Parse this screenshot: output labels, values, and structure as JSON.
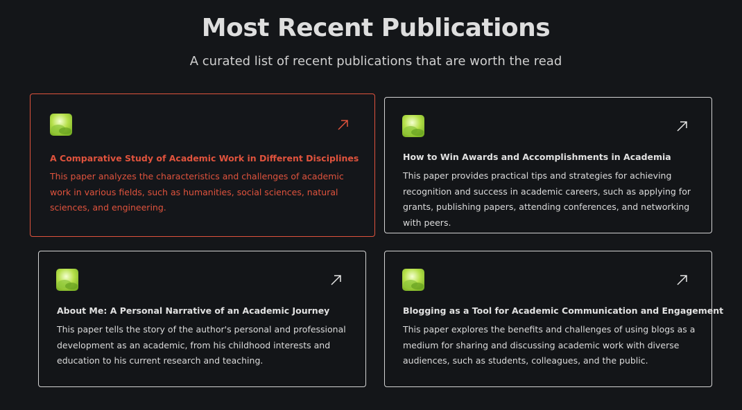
{
  "header": {
    "title": "Most Recent Publications",
    "subtitle": "A curated list of recent publications that are worth the read"
  },
  "colors": {
    "background": "#141619",
    "active_accent": "#e0533d",
    "card_border": "#d4d4d4",
    "thumbnail_green": "#9bd13a"
  },
  "cards": [
    {
      "title": "A Comparative Study of Academic Work in Different Disciplines",
      "description": "This paper analyzes the characteristics and challenges of academic work in various fields, such as humanities, social sciences, natural sciences, and engineering.",
      "icon": "arrow-up-right-icon",
      "active": true
    },
    {
      "title": "How to Win Awards and Accomplishments in Academia",
      "description": "This paper provides practical tips and strategies for achieving recognition and success in academic careers, such as applying for grants, publishing papers, attending conferences, and networking with peers.",
      "icon": "arrow-up-right-icon",
      "active": false
    },
    {
      "title": "About Me: A Personal Narrative of an Academic Journey",
      "description": "This paper tells the story of the author's personal and professional development as an academic, from his childhood interests and education to his current research and teaching.",
      "icon": "arrow-up-right-icon",
      "active": false
    },
    {
      "title": "Blogging as a Tool for Academic Communication and Engagement",
      "description": "This paper explores the benefits and challenges of using blogs as a medium for sharing and discussing academic work with diverse audiences, such as students, colleagues, and the public.",
      "icon": "arrow-up-right-icon",
      "active": false
    }
  ]
}
